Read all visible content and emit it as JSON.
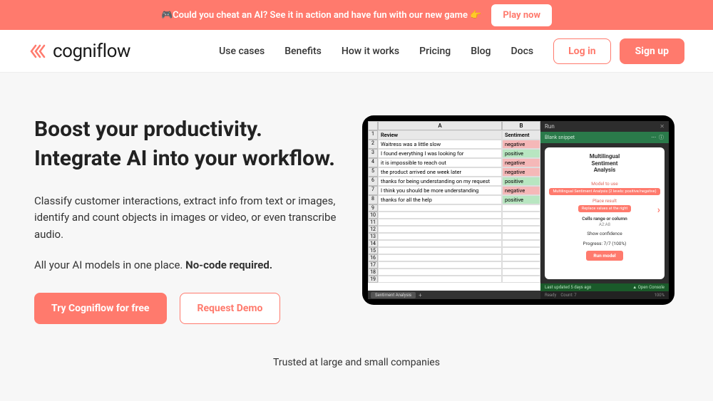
{
  "announcement": {
    "text": "🎮Could you cheat an AI? See it in action and have fun with our new game 👉",
    "cta": "Play now"
  },
  "brand": {
    "name": "cogniflow"
  },
  "nav": {
    "items": [
      "Use cases",
      "Benefits",
      "How it works",
      "Pricing",
      "Blog",
      "Docs"
    ],
    "login": "Log in",
    "signup": "Sign up"
  },
  "hero": {
    "title_line1": "Boost your productivity.",
    "title_line2": "Integrate AI into your workflow.",
    "desc": "Classify customer interactions, extract info from text or images, identify and count objects in images or video, or even transcribe audio.",
    "desc2_prefix": "All your AI models in one place. ",
    "desc2_bold": "No-code required.",
    "cta_primary": "Try Cogniflow for free",
    "cta_secondary": "Request Demo"
  },
  "sheet": {
    "colA": "A",
    "colB": "B",
    "header_review": "Review",
    "header_sentiment": "Sentiment",
    "rows": [
      {
        "n": "2",
        "text": "Waitress was a little slow",
        "sent": "negative",
        "cls": "neg"
      },
      {
        "n": "3",
        "text": "I found everything I was looking for",
        "sent": "positive",
        "cls": "pos"
      },
      {
        "n": "4",
        "text": "it is impossible to reach out",
        "sent": "negative",
        "cls": "neg"
      },
      {
        "n": "5",
        "text": "the product arrived one week later",
        "sent": "negative",
        "cls": "neg"
      },
      {
        "n": "6",
        "text": "thanks for being understanding on my request",
        "sent": "positive",
        "cls": "pos"
      },
      {
        "n": "7",
        "text": "I think you should be more understanding",
        "sent": "negative",
        "cls": "neg"
      },
      {
        "n": "8",
        "text": "thanks for all the help",
        "sent": "positive",
        "cls": "pos"
      }
    ],
    "empty_rows": [
      "9",
      "10",
      "11",
      "12",
      "13",
      "14",
      "15",
      "16",
      "17",
      "18",
      "19"
    ],
    "tab": "Sentiment Analysis"
  },
  "run": {
    "title": "Run",
    "snippet": "Blank snippet",
    "card_title1": "Multilingual",
    "card_title2": "Sentiment",
    "card_title3": "Analysis",
    "model_label": "Model to use",
    "model_pill": "Multilingual Sentiment Analysis (2 levels: positive/negative)",
    "place_label": "Place result",
    "place_pill": "Replace values at the right",
    "range_label": "Cells range or column",
    "range_val": "A2:A8",
    "confidence": "Show confidence",
    "progress": "Progress: 7/7 (100%)",
    "btn": "Run model",
    "footer_left": "Last updated 5 days ago",
    "footer_right": "▲ Open Console",
    "status_ready": "Ready",
    "status_count": "Count: 7",
    "status_zoom": "100%"
  },
  "trusted": "Trusted at large and small companies"
}
